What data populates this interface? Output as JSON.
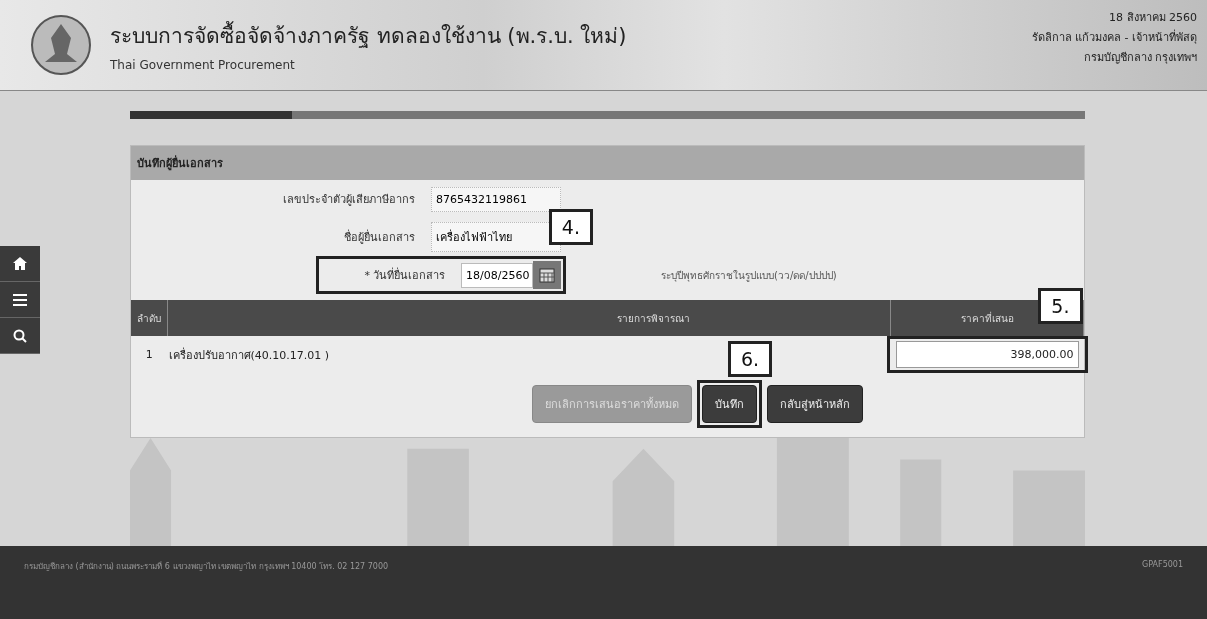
{
  "header": {
    "title": "ระบบการจัดซื้อจัดจ้างภาครัฐ ทดลองใช้งาน (พ.ร.บ. ใหม่)",
    "subtitle": "Thai Government Procurement",
    "date": "18 สิงหาคม 2560",
    "user": "รัดลิกาล แก้วมงคล - เจ้าหน้าที่พัสดุ",
    "org": "กรมบัญชีกลาง กรุงเทพฯ"
  },
  "progress": {
    "level": 0.17
  },
  "sidebar": [
    {
      "kind": "home"
    },
    {
      "kind": "menu"
    },
    {
      "kind": "search"
    }
  ],
  "form": {
    "title": "บันทึกผู้ยื่นเอกสาร",
    "fields": [
      {
        "kind": "text",
        "label": "เลขประจำตัวผู้เสียภาษีอากร",
        "value": "8765432119861"
      },
      {
        "kind": "text",
        "label": "ชื่อผู้ยื่นเอกสาร",
        "value": "เครื่องไฟฟ้าไทย"
      },
      {
        "kind": "date",
        "marker": "*",
        "label": "วันที่ยื่นเอกสาร",
        "value": "18/08/2560",
        "hint": "ระบุปีพุทธศักราชในรูปแบบ(วว/ดด/ปปปป)",
        "callout": "4."
      }
    ]
  },
  "table": {
    "columns": [
      "ลำดับ",
      "รายการพิจารณา",
      "ราคาที่เสนอ"
    ],
    "rows": [
      {
        "index": "1",
        "item": "เครื่องปรับอากาศ(40.10.17.01 )",
        "price": "398,000.00",
        "callout": "5."
      }
    ]
  },
  "buttons": [
    {
      "label": "ยกเลิกการเสนอราคาทั้งหมด",
      "disabled": true
    },
    {
      "label": "บันทึก",
      "disabled": false,
      "callout": "6."
    },
    {
      "label": "กลับสู่หน้าหลัก",
      "disabled": false
    }
  ],
  "footer": {
    "text": "กรมบัญชีกลาง (สำนักงาน) ถนนพระรามที่ 6 แขวงพญาไท เขตพญาไท กรุงเทพฯ 10400 โทร. 02 127 7000",
    "code": "GPAF5001"
  }
}
